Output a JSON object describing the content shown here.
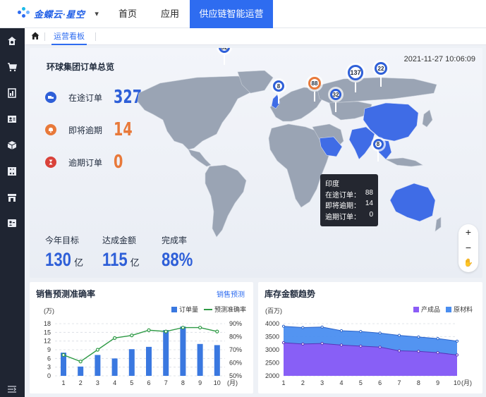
{
  "topbar": {
    "brand": "金蝶云·星空",
    "nav": [
      "首页",
      "应用"
    ],
    "active_app": "供应链智能运营"
  },
  "breadcrumb": {
    "tab": "运营看板"
  },
  "hero": {
    "title": "环球集团订单总览",
    "timestamp": "2021-11-27 10:06:09",
    "kpis": [
      {
        "label": "在途订单",
        "value": "327",
        "color": "#2e5fd8",
        "icon": "truck-icon"
      },
      {
        "label": "即将逾期",
        "value": "14",
        "color": "#e8793a",
        "icon": "bell-icon"
      },
      {
        "label": "逾期订单",
        "value": "0",
        "color": "#e8793a",
        "icon": "hourglass-icon"
      }
    ],
    "targets": [
      {
        "label": "今年目标",
        "value": "130",
        "unit": "亿"
      },
      {
        "label": "达成金额",
        "value": "115",
        "unit": "亿"
      },
      {
        "label": "完成率",
        "value": "88%",
        "unit": ""
      }
    ],
    "map_markers": [
      {
        "name": "英国",
        "value": "32"
      },
      {
        "name": "沙特",
        "value": "8"
      },
      {
        "name": "印度",
        "value": "88"
      },
      {
        "name": "东南亚",
        "value": "32"
      },
      {
        "name": "中国",
        "value": "137"
      },
      {
        "name": "日本",
        "value": "22"
      },
      {
        "name": "澳大利亚",
        "value": "8"
      }
    ],
    "tooltip": {
      "country": "印度",
      "rows": [
        {
          "k": "在途订单：",
          "v": "88"
        },
        {
          "k": "即将逾期：",
          "v": "14"
        },
        {
          "k": "逾期订单：",
          "v": "0"
        }
      ]
    },
    "zoom": {
      "in": "+",
      "out": "−",
      "pan": "✋"
    }
  },
  "sales_panel": {
    "title": "销售预测准确率",
    "link": "销售预测",
    "legend_bar": "订单量",
    "legend_line": "预测准确率",
    "unit_left": "(万)",
    "unit_x": "(月)"
  },
  "inventory_panel": {
    "title": "库存金额趋势",
    "legend_a": "产成品",
    "legend_b": "原材料",
    "unit_left": "(百万)",
    "unit_x": "(月)"
  },
  "chart_data": [
    {
      "type": "bar",
      "title": "销售预测准确率",
      "categories": [
        "1",
        "2",
        "3",
        "4",
        "5",
        "6",
        "7",
        "8",
        "9",
        "10"
      ],
      "y_ticks": [
        "0",
        "3",
        "6",
        "9",
        "12",
        "15",
        "18"
      ],
      "y2_ticks": [
        "50%",
        "60%",
        "70%",
        "80%",
        "90%"
      ],
      "ylim": [
        0,
        18
      ],
      "y2lim": [
        50,
        90
      ],
      "series": [
        {
          "name": "订单量",
          "kind": "bar",
          "values": [
            8,
            3.2,
            7.2,
            6,
            9.2,
            10,
            15.8,
            17,
            11,
            10.6
          ],
          "color": "#3a78e0"
        },
        {
          "name": "预测准确率",
          "kind": "line",
          "axis": "right",
          "values": [
            66,
            61,
            70,
            79,
            81,
            85,
            84,
            87,
            87,
            84
          ],
          "color": "#2e9a45"
        }
      ]
    },
    {
      "type": "area",
      "title": "库存金额趋势",
      "categories": [
        "1",
        "2",
        "3",
        "4",
        "5",
        "6",
        "7",
        "8",
        "9",
        "10"
      ],
      "y_ticks": [
        "2000",
        "2500",
        "3000",
        "3500",
        "4000"
      ],
      "ylim": [
        2000,
        4000
      ],
      "series": [
        {
          "name": "产成品",
          "values": [
            3270,
            3220,
            3240,
            3180,
            3140,
            3100,
            2960,
            2940,
            2890,
            2800
          ],
          "color": "#8b5cf6"
        },
        {
          "name": "原材料",
          "values": [
            3900,
            3850,
            3870,
            3730,
            3700,
            3640,
            3550,
            3490,
            3430,
            3330
          ],
          "color": "#4a8ef0"
        }
      ]
    }
  ]
}
